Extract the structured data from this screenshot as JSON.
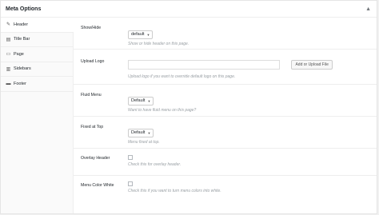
{
  "metabox": {
    "title": "Meta Options"
  },
  "tabs": [
    {
      "label": "Header",
      "icon": "pin-icon"
    },
    {
      "label": "Title Bar",
      "icon": "format-icon"
    },
    {
      "label": "Page",
      "icon": "page-icon"
    },
    {
      "label": "Sidebars",
      "icon": "sidebar-icon"
    },
    {
      "label": "Footer",
      "icon": "footer-icon"
    }
  ],
  "fields": {
    "show_hide": {
      "label": "Show/Hide",
      "value": "default",
      "desc": "Show or hide header on this page."
    },
    "upload_logo": {
      "label": "Upload Logo",
      "value": "",
      "button": "Add or Upload File",
      "desc": "Upload logo if you want to override default logo on this page."
    },
    "fluid_menu": {
      "label": "Fluid Menu",
      "value": "Default",
      "desc": "Want to have fluid menu on this page?"
    },
    "fixed_top": {
      "label": "Fixed at Top",
      "value": "Default",
      "desc": "Menu fixed at top."
    },
    "overlay_header": {
      "label": "Overlay Header",
      "checked": false,
      "desc": "Check this for overlay header."
    },
    "menu_color_white": {
      "label": "Menu Color White",
      "checked": false,
      "desc": "Check this if you want to turn menu colors into white."
    }
  }
}
